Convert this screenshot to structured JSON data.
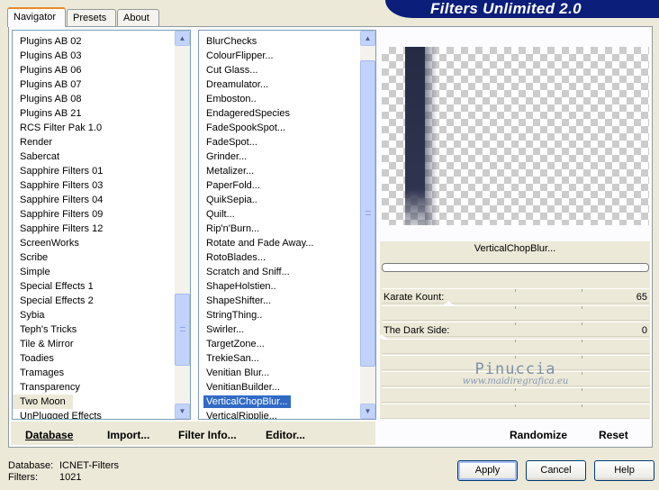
{
  "app": {
    "title": "Filters Unlimited 2.0"
  },
  "tabs": [
    {
      "label": "Navigator",
      "active": true
    },
    {
      "label": "Presets",
      "active": false
    },
    {
      "label": "About",
      "active": false
    }
  ],
  "categories": {
    "items": [
      "Plugins AB 02",
      "Plugins AB 03",
      "Plugins AB 06",
      "Plugins AB 07",
      "Plugins AB 08",
      "Plugins AB 21",
      "RCS Filter Pak 1.0",
      "Render",
      "Sabercat",
      "Sapphire Filters 01",
      "Sapphire Filters 03",
      "Sapphire Filters 04",
      "Sapphire Filters 09",
      "Sapphire Filters 12",
      "ScreenWorks",
      "Scribe",
      "Simple",
      "Special Effects 1",
      "Special Effects 2",
      "Sybia",
      "Teph's Tricks",
      "Tile & Mirror",
      "Toadies",
      "Tramages",
      "Transparency",
      "Two Moon",
      "UnPlugged Effects"
    ],
    "selected": "Two Moon"
  },
  "filters": {
    "items": [
      "BlurChecks",
      "ColourFlipper...",
      "Cut Glass...",
      "Dreamulator...",
      "Emboston..",
      "EndageredSpecies",
      "FadeSpookSpot...",
      "FadeSpot...",
      "Grinder...",
      "Metalizer...",
      "PaperFold...",
      "QuikSepia..",
      "Quilt...",
      "Rip'n'Burn...",
      "Rotate and Fade Away...",
      "RotoBlades...",
      "Scratch and Sniff...",
      "ShapeHolstien..",
      "ShapeShifter...",
      "StringThing..",
      "Swirler...",
      "TargetZone...",
      "TrekieSan...",
      "Venitian Blur...",
      "VenitianBuilder...",
      "VerticalChopBlur...",
      "VerticalRipplie..."
    ],
    "selected": "VerticalChopBlur..."
  },
  "preview": {
    "filter_name": "VerticalChopBlur..."
  },
  "params": [
    {
      "label": "Karate Kount:",
      "value": "65"
    },
    {
      "label": "The Dark Side:",
      "value": "0"
    }
  ],
  "watermark": {
    "name": "Pinuccia",
    "url": "www.maidiregrafica.eu"
  },
  "actions": {
    "database": "Database",
    "import": "Import...",
    "filter_info": "Filter Info...",
    "editor": "Editor...",
    "randomize": "Randomize",
    "reset": "Reset"
  },
  "status": {
    "database_label": "Database:",
    "database_value": "ICNET-Filters",
    "filters_label": "Filters:",
    "filters_value": "1021"
  },
  "buttons": {
    "apply": "Apply",
    "cancel": "Cancel",
    "help": "Help"
  },
  "colors": {
    "banner": "#0a1e7a",
    "selection": "#316ac5",
    "tab_highlight": "#e68b2c"
  }
}
